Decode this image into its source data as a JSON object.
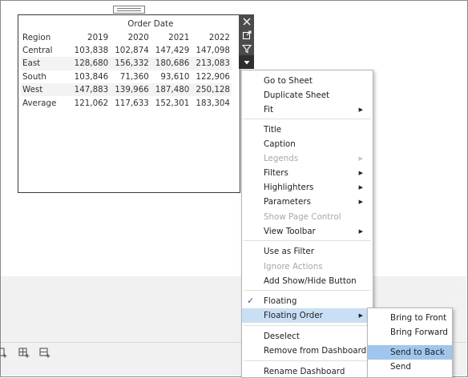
{
  "table": {
    "column_group": "Order Date",
    "row_header": "Region",
    "years": [
      "2019",
      "2020",
      "2021",
      "2022"
    ],
    "rows": [
      {
        "region": "Central",
        "values": [
          "103,838",
          "102,874",
          "147,429",
          "147,098"
        ]
      },
      {
        "region": "East",
        "values": [
          "128,680",
          "156,332",
          "180,686",
          "213,083"
        ]
      },
      {
        "region": "South",
        "values": [
          "103,846",
          "71,360",
          "93,610",
          "122,906"
        ]
      },
      {
        "region": "West",
        "values": [
          "147,883",
          "139,966",
          "187,480",
          "250,128"
        ]
      },
      {
        "region": "Average",
        "values": [
          "121,062",
          "117,633",
          "152,301",
          "183,304"
        ]
      }
    ]
  },
  "side_tools": [
    "close-icon",
    "open-sheet-icon",
    "filter-icon",
    "more-options-icon"
  ],
  "context_menu": {
    "items": [
      {
        "label": "Go to Sheet",
        "submenu": false,
        "disabled": false
      },
      {
        "label": "Duplicate Sheet",
        "submenu": false,
        "disabled": false
      },
      {
        "label": "Fit",
        "submenu": true,
        "disabled": false
      },
      {
        "label": "Title",
        "submenu": false,
        "disabled": false
      },
      {
        "label": "Caption",
        "submenu": false,
        "disabled": false
      },
      {
        "label": "Legends",
        "submenu": true,
        "disabled": true
      },
      {
        "label": "Filters",
        "submenu": true,
        "disabled": false
      },
      {
        "label": "Highlighters",
        "submenu": true,
        "disabled": false
      },
      {
        "label": "Parameters",
        "submenu": true,
        "disabled": false
      },
      {
        "label": "Show Page Control",
        "submenu": false,
        "disabled": true
      },
      {
        "label": "View Toolbar",
        "submenu": true,
        "disabled": false
      },
      {
        "label": "Use as Filter",
        "submenu": false,
        "disabled": false
      },
      {
        "label": "Ignore Actions",
        "submenu": false,
        "disabled": true
      },
      {
        "label": "Add Show/Hide Button",
        "submenu": false,
        "disabled": false
      },
      {
        "label": "Floating",
        "submenu": false,
        "disabled": false,
        "checked": true
      },
      {
        "label": "Floating Order",
        "submenu": true,
        "disabled": false,
        "highlighted": true
      },
      {
        "label": "Deselect",
        "submenu": false,
        "disabled": false
      },
      {
        "label": "Remove from Dashboard",
        "submenu": false,
        "disabled": false
      },
      {
        "label": "Rename Dashboard Item...",
        "submenu": false,
        "disabled": false
      }
    ]
  },
  "floating_order_submenu": {
    "items": [
      {
        "label": "Bring to Front"
      },
      {
        "label": "Bring Forward"
      },
      {
        "label": "Send to Back",
        "selected": true
      },
      {
        "label": "Send Backward"
      }
    ]
  },
  "colors": {
    "toolbar_bg": "#4b4b4b",
    "menu_highlight": "#c9dff5",
    "submenu_selected": "#9ec6ee",
    "check": "#1f5fa8"
  }
}
